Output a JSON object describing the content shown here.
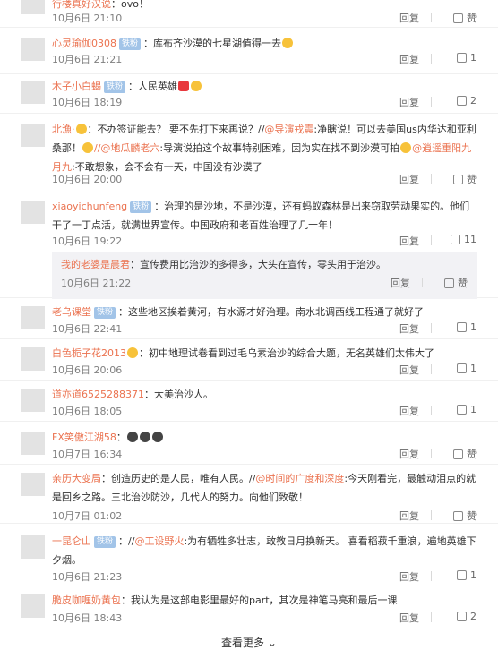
{
  "top": {
    "name": "行楼真好汉说",
    "text": "：ovo！",
    "time": "10月6日 21:10",
    "reply": "回复",
    "like": "赞"
  },
  "comments": [
    {
      "name": "心灵瑜伽0308",
      "vip": "铁粉",
      "text": "：库布齐沙漠的七星湖值得一去",
      "time": "10月6日 21:21",
      "reply": "回复",
      "like": "1"
    },
    {
      "name": "木子小白蝎",
      "vip": "铁粉",
      "text": "：人民英雄",
      "time": "10月6日 18:19",
      "reply": "回复",
      "like": "2"
    },
    {
      "name": "北漁·",
      "text": "：不办签证能去？ 要不先打下来再说？//",
      "mention1": "@导演戎震",
      "text2": ":净瞎说！可以去美国us内华达和亚利桑那！",
      "mention2": "//@地瓜麟老六",
      "text3": ":导演说拍这个故事特别困难，因为实在找不到沙漠可拍",
      "mention3": "@逍遥重阳九月九",
      "text4": ":不敢想象，会不会有一天，中国没有沙漠了",
      "time": "10月6日 20:00",
      "reply": "回复",
      "like": "赞"
    },
    {
      "name": "xiaoyichunfeng",
      "vip": "铁粉",
      "text": "：治理的是沙地，不是沙漠，还有蚂蚁森林是出来窃取劳动果实的。他们干了一丁点活，就满世界宣传。中国政府和老百姓治理了几十年！",
      "time": "10月6日 19:22",
      "reply": "回复",
      "like": "11"
    },
    {
      "name": "老乌课堂",
      "vip": "铁粉",
      "text": "：这些地区挨着黄河，有水源才好治理。南水北调西线工程通了就好了",
      "time": "10月6日 22:41",
      "reply": "回复",
      "like": "1"
    },
    {
      "name": "白色栀子花2013",
      "text": "：初中地理试卷看到过毛乌素治沙的综合大题，无名英雄们太伟大了",
      "time": "10月6日 20:06",
      "reply": "回复",
      "like": "1"
    },
    {
      "name": "道亦道6525288371",
      "text": "：大美治沙人。",
      "time": "10月6日 18:05",
      "reply": "回复",
      "like": "1"
    },
    {
      "name": "FX笑傲江湖58",
      "text": "：",
      "time": "10月7日 16:34",
      "reply": "回复",
      "like": "赞"
    },
    {
      "name": "亲历大变局",
      "text": "：创造历史的是人民，唯有人民。//",
      "mention1": "@时间的广度和深度",
      "text2": ":今天刚看完，最触动泪点的就是回乡之路。三北治沙防沙，几代人的努力。向他们致敬！",
      "time": "10月7日 01:02",
      "reply": "回复",
      "like": "赞"
    },
    {
      "name": "一昆仑山",
      "vip": "铁粉",
      "text": "：//",
      "mention1": "@工设野火",
      "text2": ":为有牺牲多壮志，敢教日月换新天。 喜看稻菽千重浪，遍地英雄下夕烟。",
      "time": "10月6日 21:23",
      "reply": "回复",
      "like": "1"
    },
    {
      "name": "脆皮咖喱奶黄包",
      "text": "：我认为是这部电影里最好的part，其次是神笔马亮和最后一课",
      "time": "10月6日 18:43",
      "reply": "回复",
      "like": "2"
    }
  ],
  "sub_reply": {
    "name": "我的老婆是晨君",
    "text": "：宣传费用比治沙的多得多，大头在宣传，零头用于治沙。",
    "time": "10月6日 21:22",
    "reply": "回复",
    "like": "赞"
  },
  "more": "查看更多"
}
